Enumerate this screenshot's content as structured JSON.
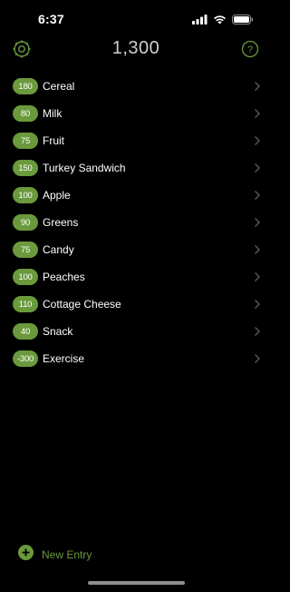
{
  "status_bar": {
    "time": "6:37",
    "icons": [
      "signal-icon",
      "wifi-icon",
      "battery-icon"
    ]
  },
  "header": {
    "total": "1,300",
    "left_icon": "settings-icon",
    "right_icon": "help-icon"
  },
  "colors": {
    "accent": "#6a9a3c",
    "background": "#000000",
    "text": "#ffffff",
    "chevron": "#5a5a5a"
  },
  "entries": [
    {
      "calories": "180",
      "name": "Cereal"
    },
    {
      "calories": "80",
      "name": "Milk"
    },
    {
      "calories": "75",
      "name": "Fruit"
    },
    {
      "calories": "150",
      "name": "Turkey Sandwich"
    },
    {
      "calories": "100",
      "name": "Apple"
    },
    {
      "calories": "90",
      "name": "Greens"
    },
    {
      "calories": "75",
      "name": "Candy"
    },
    {
      "calories": "100",
      "name": "Peaches"
    },
    {
      "calories": "110",
      "name": "Cottage Cheese"
    },
    {
      "calories": "40",
      "name": "Snack"
    },
    {
      "calories": "-300",
      "name": "Exercise"
    }
  ],
  "footer": {
    "new_entry_label": "New Entry",
    "new_entry_icon": "plus-circle-icon"
  }
}
